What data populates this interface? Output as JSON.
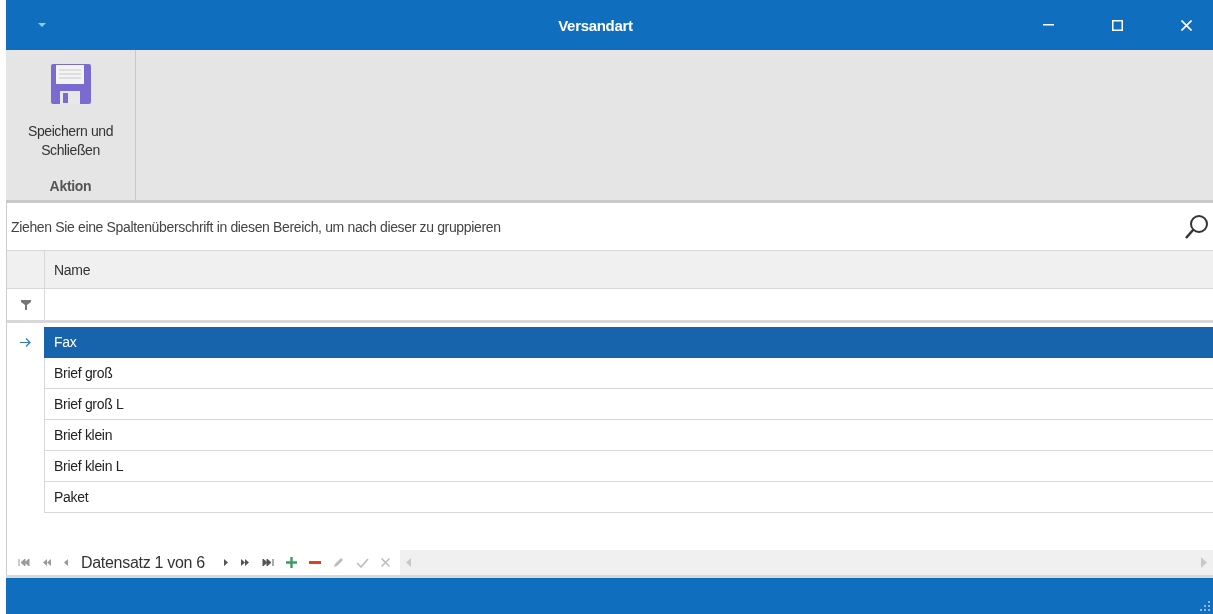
{
  "window": {
    "title": "Versandart"
  },
  "ribbon": {
    "groups": [
      {
        "label": "Aktion",
        "buttons": [
          {
            "label": "Speichern und Schließen"
          }
        ]
      }
    ]
  },
  "group_panel": {
    "placeholder": "Ziehen Sie eine Spaltenüberschrift in diesen Bereich, um nach dieser zu gruppieren"
  },
  "table": {
    "columns": [
      "Name"
    ],
    "rows": [
      {
        "name": "Fax",
        "selected": true
      },
      {
        "name": "Brief groß",
        "selected": false
      },
      {
        "name": "Brief groß L",
        "selected": false
      },
      {
        "name": "Brief klein",
        "selected": false
      },
      {
        "name": "Brief klein L",
        "selected": false
      },
      {
        "name": "Paket",
        "selected": false
      }
    ]
  },
  "navigator": {
    "text": "Datensatz 1 von 6"
  }
}
